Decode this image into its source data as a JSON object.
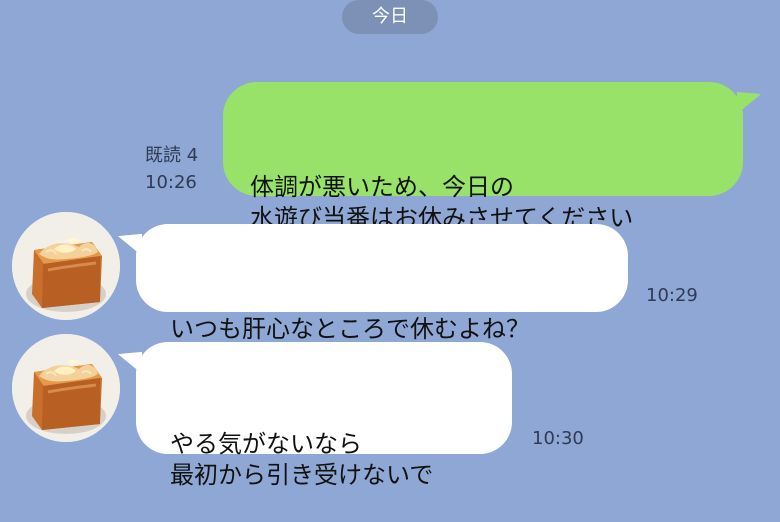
{
  "chat": {
    "date_label": "今日",
    "messages": [
      {
        "direction": "outgoing",
        "text": "体調が悪いため、今日の\n水遊び当番はお休みさせてください",
        "read_status": "既読 4",
        "time": "10:26"
      },
      {
        "direction": "incoming",
        "text": "いつも肝心なところで休むよね？",
        "time": "10:29"
      },
      {
        "direction": "incoming",
        "text": "やる気がないなら\n最初から引き受けないで",
        "time": "10:30"
      }
    ],
    "avatar": {
      "icon_name": "bread-avatar-icon"
    }
  },
  "colors": {
    "background": "#8fa7d4",
    "outgoing_bubble": "#98e269",
    "incoming_bubble": "#ffffff",
    "date_pill": "#7d90b6"
  }
}
